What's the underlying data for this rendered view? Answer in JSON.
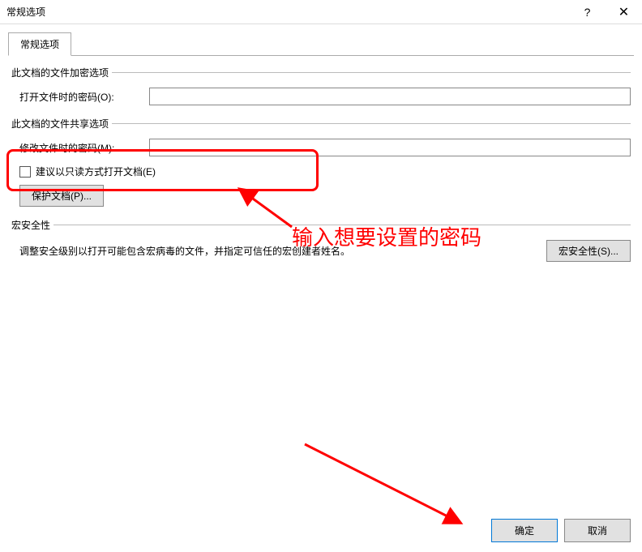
{
  "title": "常规选项",
  "tab": "常规选项",
  "encrypt": {
    "group": "此文档的文件加密选项",
    "open_label": "打开文件时的密码(O):",
    "open_value": ""
  },
  "share": {
    "group": "此文档的文件共享选项",
    "modify_label": "修改文件时的密码(M):",
    "modify_value": "",
    "readonly_label": "建议以只读方式打开文档(E)",
    "protect_btn": "保护文档(P)..."
  },
  "macro": {
    "group": "宏安全性",
    "desc": "调整安全级别以打开可能包含宏病毒的文件，并指定可信任的宏创建者姓名。",
    "btn": "宏安全性(S)..."
  },
  "footer": {
    "ok": "确定",
    "cancel": "取消"
  },
  "annotation": {
    "text": "输入想要设置的密码"
  }
}
